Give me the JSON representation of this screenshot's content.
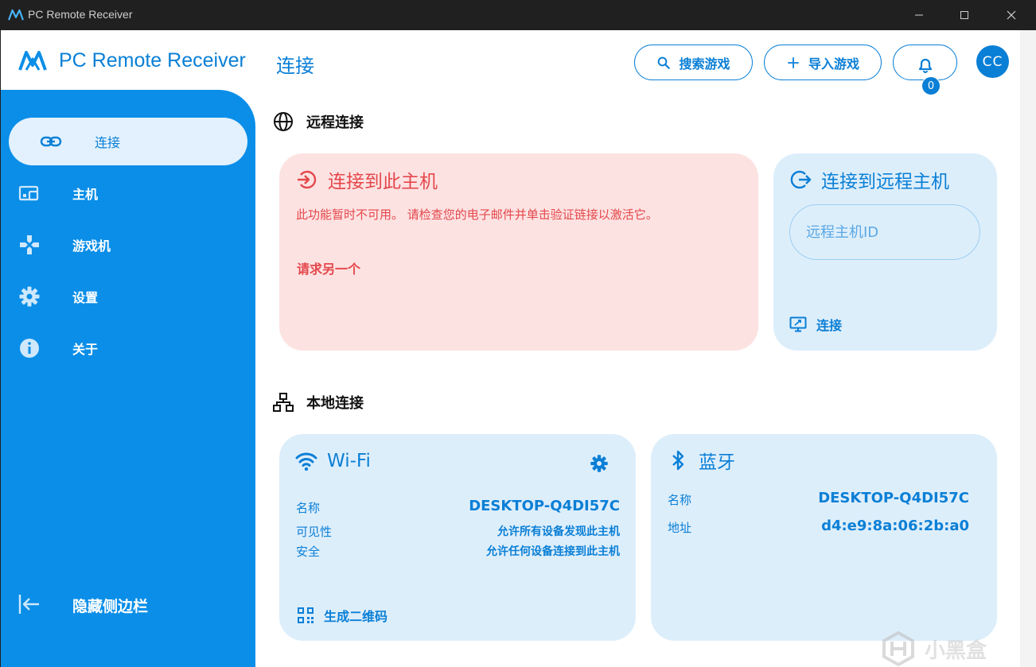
{
  "window": {
    "title": "PC Remote Receiver",
    "controls": {
      "minimize": "minimize",
      "maximize": "maximize",
      "close": "close"
    }
  },
  "header": {
    "brand": "PC Remote Receiver",
    "page_title": "连接",
    "search_button": "搜索游戏",
    "import_button": "导入游戏",
    "notification_count": "0",
    "avatar_initials": "CC"
  },
  "sidebar": {
    "items": [
      {
        "label": "连接",
        "icon": "link-icon",
        "active": true
      },
      {
        "label": "主机",
        "icon": "devices-icon",
        "active": false
      },
      {
        "label": "游戏机",
        "icon": "gamepad-icon",
        "active": false
      },
      {
        "label": "设置",
        "icon": "gear-icon",
        "active": false
      },
      {
        "label": "关于",
        "icon": "info-icon",
        "active": false
      }
    ],
    "hide_label": "隐藏侧边栏"
  },
  "remote": {
    "section_title": "远程连接",
    "this_host": {
      "title": "连接到此主机",
      "message": "此功能暂时不可用。 请检查您的电子邮件并单击验证链接以激活它。",
      "request_link": "请求另一个"
    },
    "remote_host": {
      "title": "连接到远程主机",
      "input_placeholder": "远程主机ID",
      "connect_label": "连接"
    }
  },
  "local": {
    "section_title": "本地连接",
    "wifi": {
      "title": "Wi-Fi",
      "name_label": "名称",
      "name_value": "DESKTOP-Q4DI57C",
      "visibility_label": "可见性",
      "visibility_value": "允许所有设备发现此主机",
      "security_label": "安全",
      "security_value": "允许任何设备连接到此主机",
      "qr_label": "生成二维码"
    },
    "bluetooth": {
      "title": "蓝牙",
      "name_label": "名称",
      "name_value": "DESKTOP-Q4DI57C",
      "address_label": "地址",
      "address_value": "d4:e9:8a:06:2b:a0"
    }
  },
  "watermark": {
    "text": "小黑盒"
  },
  "colors": {
    "accent": "#0a7fd6",
    "sidebar": "#0a8ee8",
    "error": "#e4474b",
    "error_bg": "#fde2e2",
    "card_bg": "#ddeefb"
  }
}
